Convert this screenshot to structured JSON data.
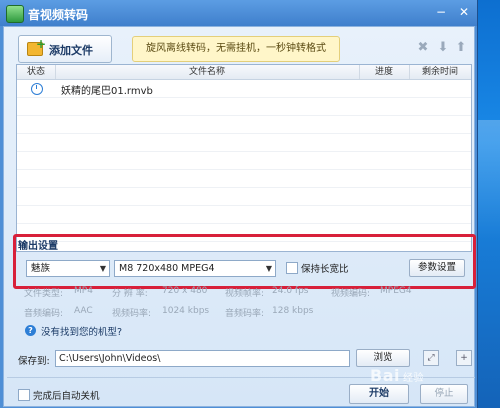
{
  "window": {
    "title": "音视频转码"
  },
  "toolbar": {
    "add_file_label": "添加文件",
    "banner_text": "旋风离线转码，无需挂机，一秒钟转格式"
  },
  "file_list": {
    "columns": [
      "状态",
      "文件名称",
      "进度",
      "剩余时间"
    ],
    "rows": [
      {
        "status_icon": "clock-icon",
        "name": "妖精的尾巴01.rmvb",
        "progress": "",
        "remaining": ""
      }
    ]
  },
  "output": {
    "section_title": "输出设置",
    "device": "魅族",
    "model": "M8 720x480 MPEG4",
    "keep_ratio_label": "保持长宽比",
    "keep_ratio_checked": false,
    "params_button": "参数设置",
    "info": {
      "file_type_label": "文件类型:",
      "file_type": "MP4",
      "resolution_label": "分 辨 率:",
      "resolution": "720 x 480",
      "video_fps_label": "视频帧率:",
      "video_fps": "24.0 fps",
      "video_codec_label": "视频编码:",
      "video_codec": "MPEG4",
      "audio_codec_label": "音频编码:",
      "audio_codec": "AAC",
      "video_bitrate_label": "视频码率:",
      "video_bitrate": "1024 kbps",
      "audio_bitrate_label": "音频码率:",
      "audio_bitrate": "128 kbps"
    },
    "missing_model_text": "没有找到您的机型?"
  },
  "save": {
    "label": "保存到:",
    "path": "C:\\Users\\John\\Videos\\",
    "browse_button": "浏览"
  },
  "footer": {
    "shutdown_label": "完成后自动关机",
    "start_button": "开始",
    "stop_button": "停止"
  },
  "watermark": {
    "brand": "Bai",
    "sub": "经验"
  },
  "colors": {
    "accent": "#2d7ed6",
    "highlight_box": "#d8203a",
    "banner_bg": "#fff6c9"
  }
}
